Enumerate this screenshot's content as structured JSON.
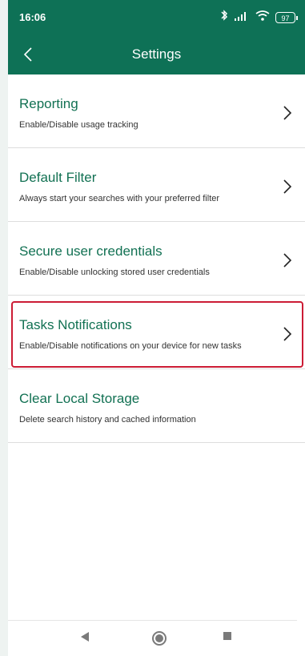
{
  "status_bar": {
    "time": "16:06",
    "battery": "97",
    "icons": [
      "bluetooth-icon",
      "signal-icon",
      "wifi-icon",
      "battery-icon"
    ]
  },
  "toolbar": {
    "title": "Settings",
    "back_icon": "back-chevron-icon"
  },
  "settings": [
    {
      "title": "Reporting",
      "description": "Enable/Disable usage tracking",
      "chevron": true
    },
    {
      "title": "Default Filter",
      "description": "Always start your searches with your preferred filter",
      "chevron": true
    },
    {
      "title": "Secure user credentials",
      "description": "Enable/Disable unlocking stored user credentials",
      "chevron": true
    },
    {
      "title": "Tasks Notifications",
      "description": "Enable/Disable notifications on your device for new tasks",
      "chevron": true
    },
    {
      "title": "Clear Local Storage",
      "description": "Delete search history and cached information",
      "chevron": false
    }
  ],
  "navigation": [
    "back-triangle-icon",
    "home-circle-icon",
    "recents-square-icon"
  ],
  "colors": {
    "header": "#0e7156",
    "accent": "#127153",
    "highlight": "#cc1c35"
  }
}
